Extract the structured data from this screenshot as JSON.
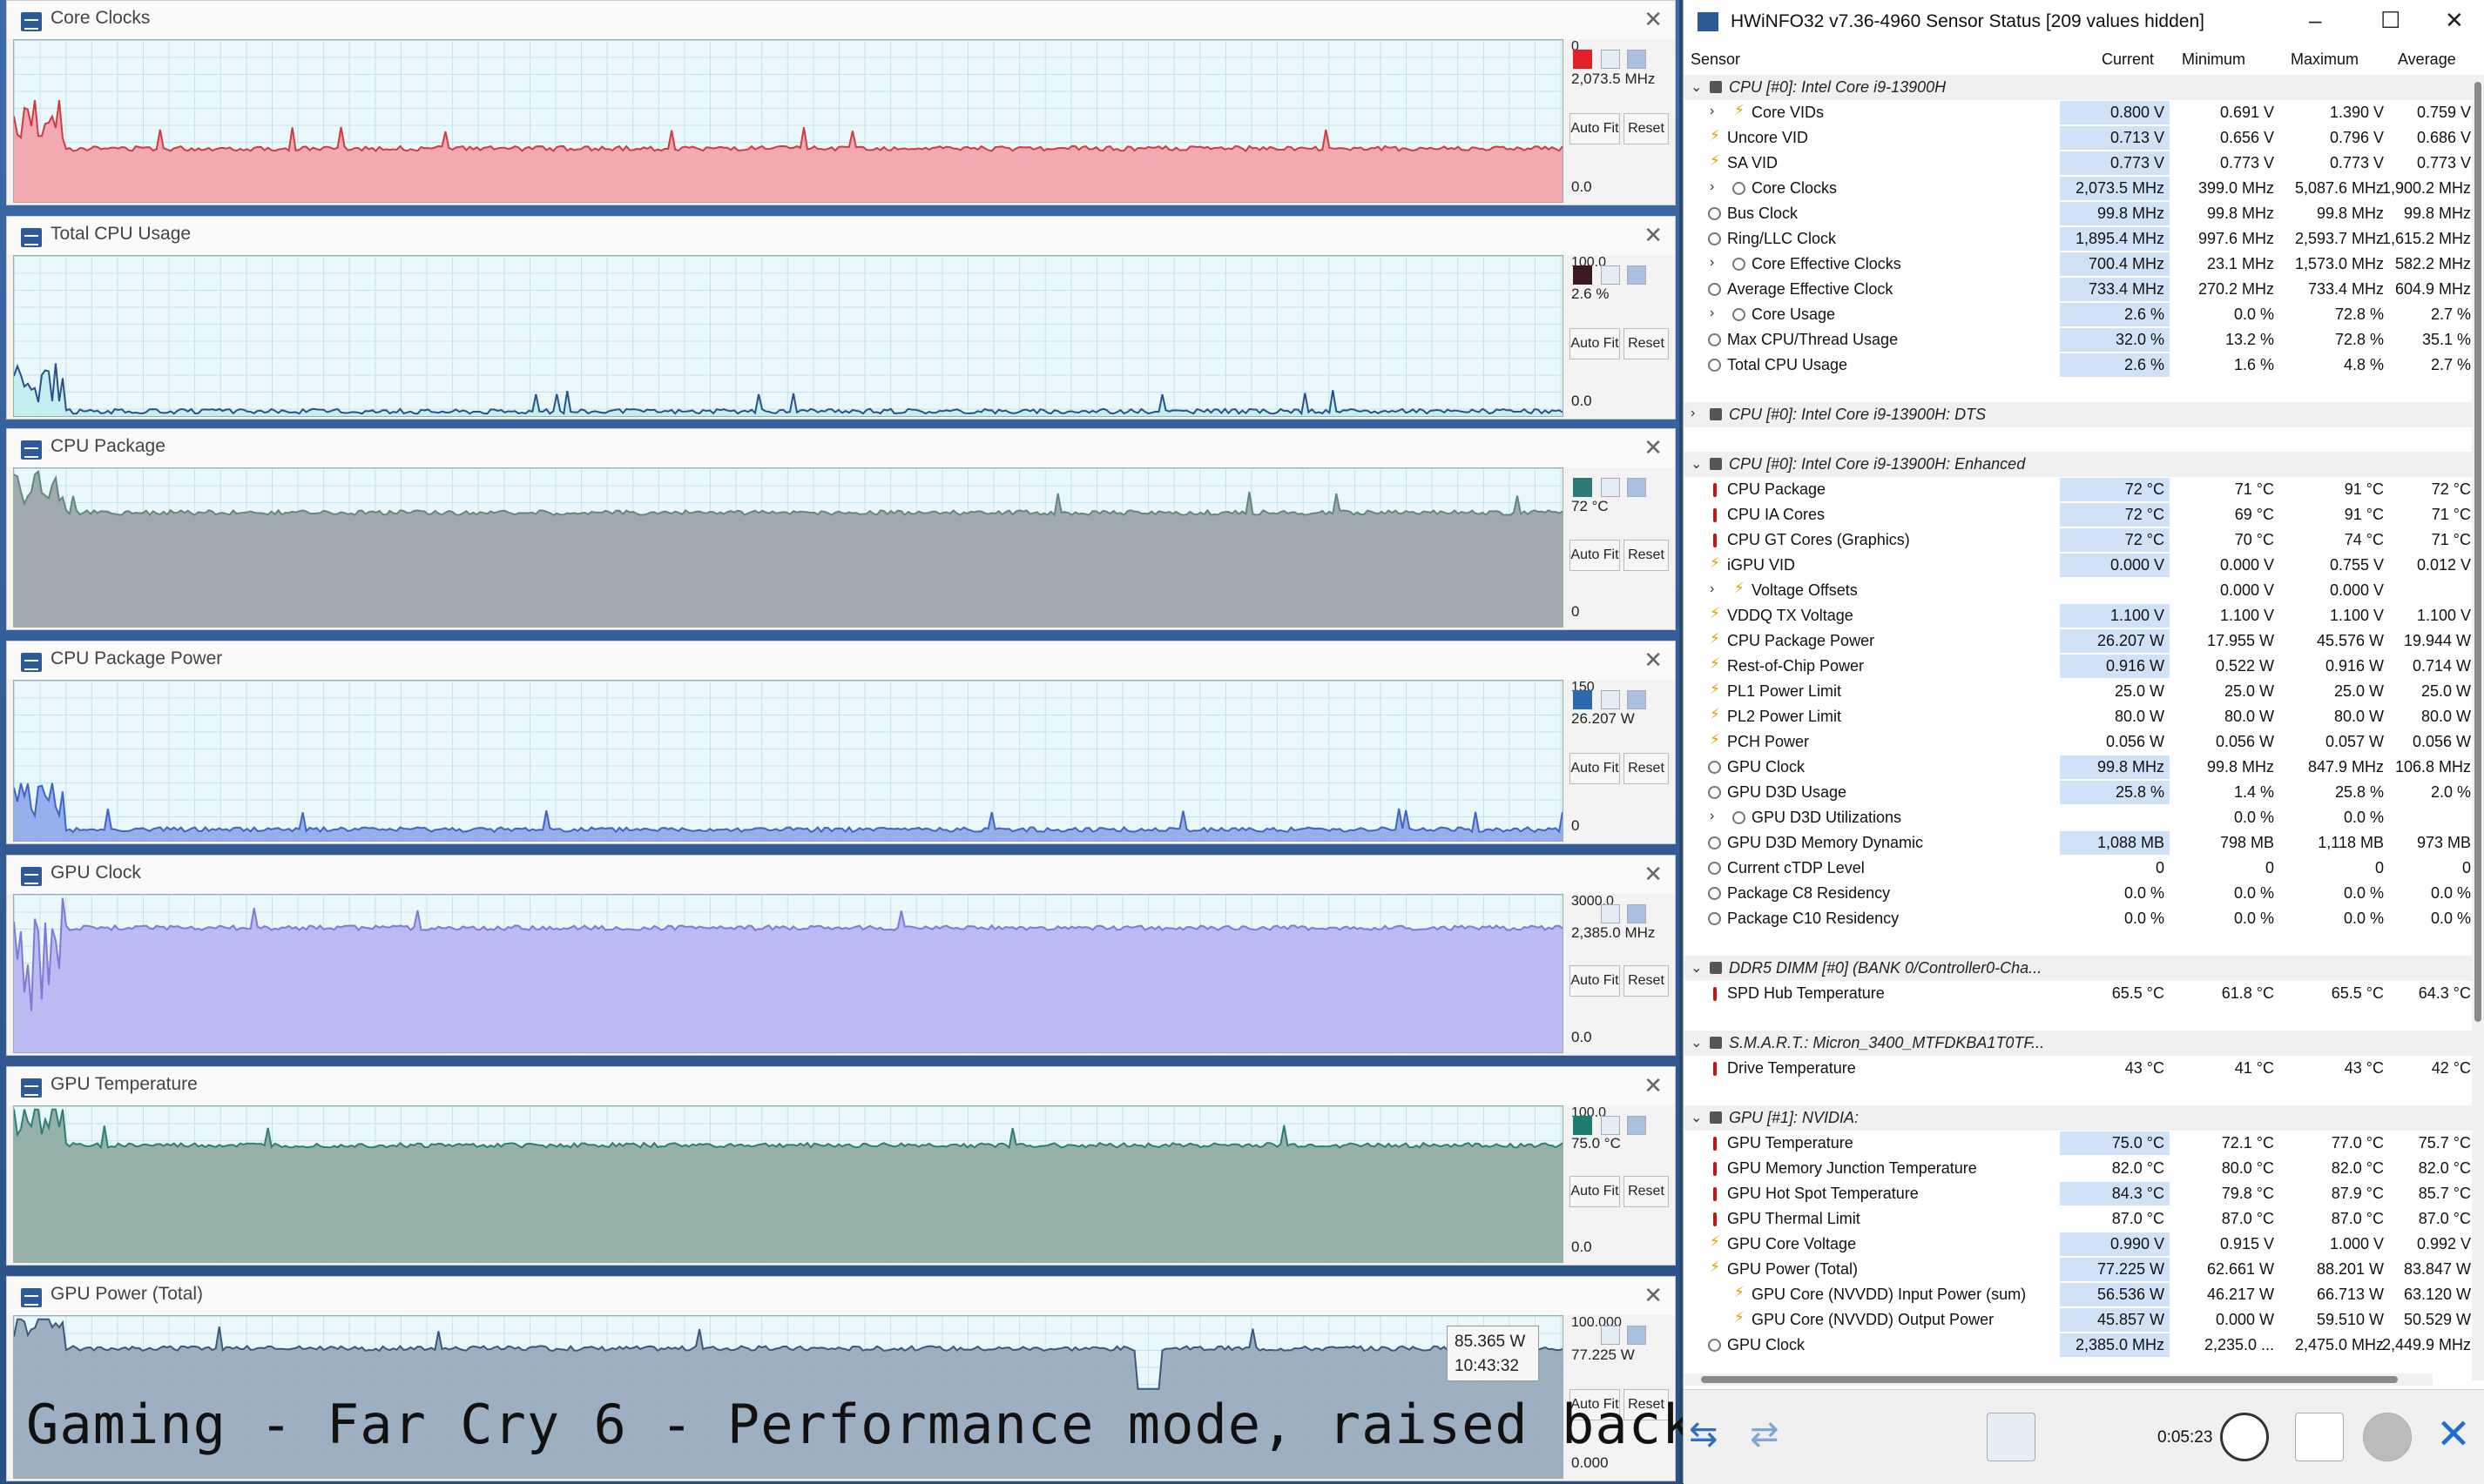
{
  "caption": "Gaming - Far Cry 6 - Performance mode, raised back",
  "graphs": [
    {
      "title": "Core Clocks",
      "top_label": "0",
      "current": "2,073.5 MHz",
      "auto_fit": "Auto Fit",
      "reset": "Reset",
      "zero": "0.0",
      "color": "#f2a2a8",
      "line": "#d03a44",
      "swatch": "#e2202a",
      "level": 0.33
    },
    {
      "title": "Total CPU Usage",
      "top_label": "100.0",
      "current": "2.6 %",
      "auto_fit": "Auto Fit",
      "reset": "Reset",
      "zero": "0.0",
      "color": "#bfeef0",
      "line": "#2a4f8a",
      "swatch": "#3a1a20",
      "level": 0.03
    },
    {
      "title": "CPU Package",
      "top_label": "",
      "current": "72 °C",
      "auto_fit": "Auto Fit",
      "reset": "Reset",
      "zero": "0",
      "color": "#9aa4a8",
      "line": "#5f8a7c",
      "swatch": "#2e7a74",
      "level": 0.72
    },
    {
      "title": "CPU Package Power",
      "top_label": "150",
      "current": "26.207 W",
      "auto_fit": "Auto Fit",
      "reset": "Reset",
      "zero": "0",
      "color": "#8fa8e8",
      "line": "#3f63c8",
      "swatch": "#2e69b0",
      "level": 0.07
    },
    {
      "title": "GPU Clock",
      "top_label": "3000.0",
      "current": "2,385.0 MHz",
      "auto_fit": "Auto Fit",
      "reset": "Reset",
      "zero": "0.0",
      "color": "#b7b5f2",
      "line": "#7d7ad8",
      "swatch": "",
      "level": 0.79
    },
    {
      "title": "GPU Temperature",
      "top_label": "100.0",
      "current": "75.0 °C",
      "auto_fit": "Auto Fit",
      "reset": "Reset",
      "zero": "0.0",
      "color": "#8eaaa2",
      "line": "#2e7e74",
      "swatch": "#1e7c72",
      "level": 0.75
    },
    {
      "title": "GPU Power (Total)",
      "top_label": "100.000",
      "current": "77.225 W",
      "auto_fit": "Auto Fit",
      "reset": "Reset",
      "zero": "0.000",
      "color": "#96a9bc",
      "line": "#3b587a",
      "swatch": "",
      "level": 0.8,
      "tooltip": {
        "value": "85.365 W",
        "time": "10:43:32"
      }
    }
  ],
  "hwinfo": {
    "title": "HWiNFO32 v7.36-4960 Sensor Status [209 values hidden]",
    "columns": [
      "Sensor",
      "Current",
      "Minimum",
      "Maximum",
      "Average"
    ],
    "rows": [
      {
        "type": "group",
        "name": "CPU [#0]: Intel Core i9-13900H",
        "y": 98
      },
      {
        "type": "item",
        "icon": "v",
        "indent": 1,
        "twisty": true,
        "name": "Core VIDs",
        "cur": "0.800 V",
        "min": "0.691 V",
        "max": "1.390 V",
        "avg": "0.759 V",
        "hl": true
      },
      {
        "type": "item",
        "icon": "b",
        "name": "Uncore VID",
        "cur": "0.713 V",
        "min": "0.656 V",
        "max": "0.796 V",
        "avg": "0.686 V",
        "hl": true
      },
      {
        "type": "item",
        "icon": "b",
        "name": "SA VID",
        "cur": "0.773 V",
        "min": "0.773 V",
        "max": "0.773 V",
        "avg": "0.773 V",
        "hl": true
      },
      {
        "type": "item",
        "icon": "c",
        "indent": 1,
        "twisty": true,
        "name": "Core Clocks",
        "cur": "2,073.5 MHz",
        "min": "399.0 MHz",
        "max": "5,087.6 MHz",
        "avg": "1,900.2 MHz",
        "hl": true
      },
      {
        "type": "item",
        "icon": "c",
        "name": "Bus Clock",
        "cur": "99.8 MHz",
        "min": "99.8 MHz",
        "max": "99.8 MHz",
        "avg": "99.8 MHz",
        "hl": true
      },
      {
        "type": "item",
        "icon": "c",
        "name": "Ring/LLC Clock",
        "cur": "1,895.4 MHz",
        "min": "997.6 MHz",
        "max": "2,593.7 MHz",
        "avg": "1,615.2 MHz",
        "hl": true
      },
      {
        "type": "item",
        "icon": "c",
        "indent": 1,
        "twisty": true,
        "name": "Core Effective Clocks",
        "cur": "700.4 MHz",
        "min": "23.1 MHz",
        "max": "1,573.0 MHz",
        "avg": "582.2 MHz",
        "hl": true
      },
      {
        "type": "item",
        "icon": "c",
        "name": "Average Effective Clock",
        "cur": "733.4 MHz",
        "min": "270.2 MHz",
        "max": "733.4 MHz",
        "avg": "604.9 MHz",
        "hl": true
      },
      {
        "type": "item",
        "icon": "c",
        "indent": 1,
        "twisty": true,
        "name": "Core Usage",
        "cur": "2.6 %",
        "min": "0.0 %",
        "max": "72.8 %",
        "avg": "2.7 %",
        "hl": true
      },
      {
        "type": "item",
        "icon": "c",
        "name": "Max CPU/Thread Usage",
        "cur": "32.0 %",
        "min": "13.2 %",
        "max": "72.8 %",
        "avg": "35.1 %",
        "hl": true
      },
      {
        "type": "item",
        "icon": "c",
        "name": "Total CPU Usage",
        "cur": "2.6 %",
        "min": "1.6 %",
        "max": "4.8 %",
        "avg": "2.7 %",
        "hl": true
      },
      {
        "type": "spacer"
      },
      {
        "type": "group",
        "collapsed": true,
        "name": "CPU [#0]: Intel Core i9-13900H: DTS"
      },
      {
        "type": "spacer"
      },
      {
        "type": "group",
        "name": "CPU [#0]: Intel Core i9-13900H: Enhanced"
      },
      {
        "type": "item",
        "icon": "t",
        "name": "CPU Package",
        "cur": "72 °C",
        "min": "71 °C",
        "max": "91 °C",
        "avg": "72 °C",
        "hl": true
      },
      {
        "type": "item",
        "icon": "t",
        "name": "CPU IA Cores",
        "cur": "72 °C",
        "min": "69 °C",
        "max": "91 °C",
        "avg": "71 °C",
        "hl": true
      },
      {
        "type": "item",
        "icon": "t",
        "name": "CPU GT Cores (Graphics)",
        "cur": "72 °C",
        "min": "70 °C",
        "max": "74 °C",
        "avg": "71 °C",
        "hl": true
      },
      {
        "type": "item",
        "icon": "b",
        "name": "iGPU VID",
        "cur": "0.000 V",
        "min": "0.000 V",
        "max": "0.755 V",
        "avg": "0.012 V",
        "hl": true
      },
      {
        "type": "item",
        "icon": "v",
        "indent": 1,
        "twisty": true,
        "name": "Voltage Offsets",
        "cur": "",
        "min": "0.000 V",
        "max": "0.000 V",
        "avg": "",
        "hl": false
      },
      {
        "type": "item",
        "icon": "b",
        "name": "VDDQ TX Voltage",
        "cur": "1.100 V",
        "min": "1.100 V",
        "max": "1.100 V",
        "avg": "1.100 V",
        "hl": true
      },
      {
        "type": "item",
        "icon": "b",
        "name": "CPU Package Power",
        "cur": "26.207 W",
        "min": "17.955 W",
        "max": "45.576 W",
        "avg": "19.944 W",
        "hl": true
      },
      {
        "type": "item",
        "icon": "b",
        "name": "Rest-of-Chip Power",
        "cur": "0.916 W",
        "min": "0.522 W",
        "max": "0.916 W",
        "avg": "0.714 W",
        "hl": true
      },
      {
        "type": "item",
        "icon": "b",
        "name": "PL1 Power Limit",
        "cur": "25.0 W",
        "min": "25.0 W",
        "max": "25.0 W",
        "avg": "25.0 W",
        "hl": false
      },
      {
        "type": "item",
        "icon": "b",
        "name": "PL2 Power Limit",
        "cur": "80.0 W",
        "min": "80.0 W",
        "max": "80.0 W",
        "avg": "80.0 W",
        "hl": false
      },
      {
        "type": "item",
        "icon": "b",
        "name": "PCH Power",
        "cur": "0.056 W",
        "min": "0.056 W",
        "max": "0.057 W",
        "avg": "0.056 W",
        "hl": false
      },
      {
        "type": "item",
        "icon": "c",
        "name": "GPU Clock",
        "cur": "99.8 MHz",
        "min": "99.8 MHz",
        "max": "847.9 MHz",
        "avg": "106.8 MHz",
        "hl": true
      },
      {
        "type": "item",
        "icon": "c",
        "name": "GPU D3D Usage",
        "cur": "25.8 %",
        "min": "1.4 %",
        "max": "25.8 %",
        "avg": "2.0 %",
        "hl": true
      },
      {
        "type": "item",
        "icon": "c",
        "indent": 1,
        "twisty": true,
        "name": "GPU D3D Utilizations",
        "cur": "",
        "min": "0.0 %",
        "max": "0.0 %",
        "avg": "",
        "hl": false
      },
      {
        "type": "item",
        "icon": "c",
        "name": "GPU D3D Memory Dynamic",
        "cur": "1,088 MB",
        "min": "798 MB",
        "max": "1,118 MB",
        "avg": "973 MB",
        "hl": true
      },
      {
        "type": "item",
        "icon": "c",
        "name": "Current cTDP Level",
        "cur": "0",
        "min": "0",
        "max": "0",
        "avg": "0",
        "hl": false
      },
      {
        "type": "item",
        "icon": "c",
        "name": "Package C8 Residency",
        "cur": "0.0 %",
        "min": "0.0 %",
        "max": "0.0 %",
        "avg": "0.0 %",
        "hl": false
      },
      {
        "type": "item",
        "icon": "c",
        "name": "Package C10 Residency",
        "cur": "0.0 %",
        "min": "0.0 %",
        "max": "0.0 %",
        "avg": "0.0 %",
        "hl": false
      },
      {
        "type": "spacer"
      },
      {
        "type": "group",
        "name": "DDR5 DIMM [#0] (BANK 0/Controller0-Cha..."
      },
      {
        "type": "item",
        "icon": "t",
        "name": "SPD Hub Temperature",
        "cur": "65.5 °C",
        "min": "61.8 °C",
        "max": "65.5 °C",
        "avg": "64.3 °C",
        "hl": false
      },
      {
        "type": "spacer"
      },
      {
        "type": "group",
        "name": "S.M.A.R.T.: Micron_3400_MTFDKBA1T0TF..."
      },
      {
        "type": "item",
        "icon": "t",
        "name": "Drive Temperature",
        "cur": "43 °C",
        "min": "41 °C",
        "max": "43 °C",
        "avg": "42 °C",
        "hl": false
      },
      {
        "type": "spacer"
      },
      {
        "type": "group",
        "name": "GPU [#1]: NVIDIA:"
      },
      {
        "type": "item",
        "icon": "t",
        "name": "GPU Temperature",
        "cur": "75.0 °C",
        "min": "72.1 °C",
        "max": "77.0 °C",
        "avg": "75.7 °C",
        "hl": true
      },
      {
        "type": "item",
        "icon": "t",
        "name": "GPU Memory Junction Temperature",
        "cur": "82.0 °C",
        "min": "80.0 °C",
        "max": "82.0 °C",
        "avg": "82.0 °C",
        "hl": false
      },
      {
        "type": "item",
        "icon": "t",
        "name": "GPU Hot Spot Temperature",
        "cur": "84.3 °C",
        "min": "79.8 °C",
        "max": "87.9 °C",
        "avg": "85.7 °C",
        "hl": true
      },
      {
        "type": "item",
        "icon": "t",
        "name": "GPU Thermal Limit",
        "cur": "87.0 °C",
        "min": "87.0 °C",
        "max": "87.0 °C",
        "avg": "87.0 °C",
        "hl": false
      },
      {
        "type": "item",
        "icon": "b",
        "name": "GPU Core Voltage",
        "cur": "0.990 V",
        "min": "0.915 V",
        "max": "1.000 V",
        "avg": "0.992 V",
        "hl": true
      },
      {
        "type": "item",
        "icon": "b",
        "name": "GPU Power (Total)",
        "cur": "77.225 W",
        "min": "62.661 W",
        "max": "88.201 W",
        "avg": "83.847 W",
        "hl": true
      },
      {
        "type": "item",
        "icon": "b",
        "indent": 1,
        "name": "GPU Core (NVVDD) Input Power (sum)",
        "cur": "56.536 W",
        "min": "46.217 W",
        "max": "66.713 W",
        "avg": "63.120 W",
        "hl": true
      },
      {
        "type": "item",
        "icon": "b",
        "indent": 1,
        "name": "GPU Core (NVVDD) Output Power",
        "cur": "45.857 W",
        "min": "0.000 W",
        "max": "59.510 W",
        "avg": "50.529 W",
        "hl": true
      },
      {
        "type": "item",
        "icon": "c",
        "name": "GPU Clock",
        "cur": "2,385.0 MHz",
        "min": "2,235.0 ...",
        "max": "2,475.0 MHz",
        "avg": "2,449.9 MHz",
        "hl": true
      }
    ],
    "elapsed": "0:05:23"
  }
}
